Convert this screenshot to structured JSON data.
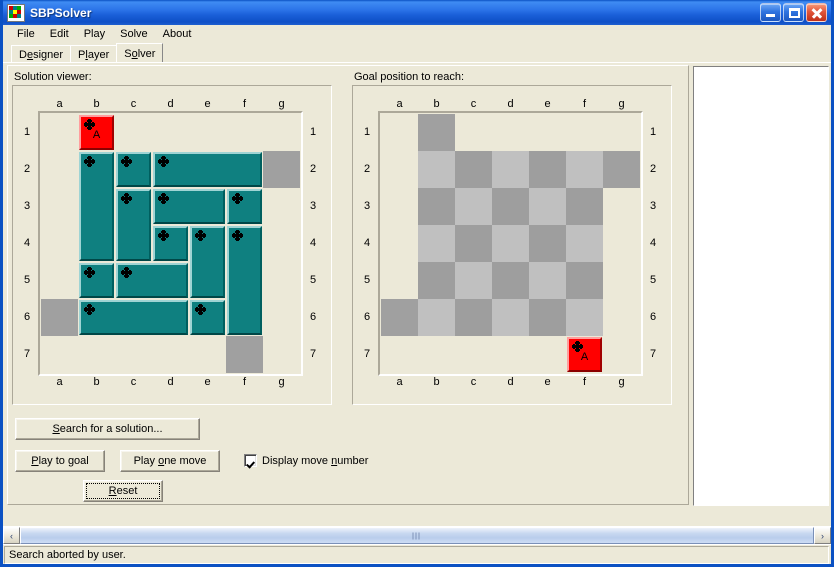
{
  "window": {
    "title": "SBPSolver",
    "icon": "app-icon",
    "buttons": {
      "minimize": "minimize",
      "maximize": "maximize",
      "close": "close"
    }
  },
  "menu": [
    {
      "label": "File"
    },
    {
      "label": "Edit"
    },
    {
      "label": "Play"
    },
    {
      "label": "Solve"
    },
    {
      "label": "About"
    }
  ],
  "tabs": [
    {
      "label": "Designer",
      "accel": "D",
      "selected": false
    },
    {
      "label": "Player",
      "accel": "l",
      "selected": false
    },
    {
      "label": "Solver",
      "accel": "o",
      "selected": true
    }
  ],
  "solver": {
    "left_label": "Solution viewer:",
    "right_label": "Goal position to reach:",
    "columns": [
      "a",
      "b",
      "c",
      "d",
      "e",
      "f",
      "g"
    ],
    "rows": [
      "1",
      "2",
      "3",
      "4",
      "5",
      "6",
      "7"
    ],
    "solution_board": {
      "blockers": [
        {
          "col": 6,
          "row": 1
        },
        {
          "col": 0,
          "row": 5
        },
        {
          "col": 5,
          "row": 6
        }
      ],
      "pieces": [
        {
          "label": "A",
          "color": "red",
          "col": 1,
          "row": 0,
          "w": 1,
          "h": 1
        },
        {
          "label": "",
          "color": "teal",
          "col": 1,
          "row": 1,
          "w": 1,
          "h": 3
        },
        {
          "label": "",
          "color": "teal",
          "col": 2,
          "row": 1,
          "w": 1,
          "h": 1
        },
        {
          "label": "",
          "color": "teal",
          "col": 3,
          "row": 1,
          "w": 3,
          "h": 1
        },
        {
          "label": "",
          "color": "teal",
          "col": 2,
          "row": 2,
          "w": 1,
          "h": 2
        },
        {
          "label": "",
          "color": "teal",
          "col": 3,
          "row": 2,
          "w": 2,
          "h": 1
        },
        {
          "label": "",
          "color": "teal",
          "col": 5,
          "row": 2,
          "w": 1,
          "h": 1
        },
        {
          "label": "",
          "color": "teal",
          "col": 3,
          "row": 3,
          "w": 1,
          "h": 1
        },
        {
          "label": "",
          "color": "teal",
          "col": 4,
          "row": 3,
          "w": 1,
          "h": 2
        },
        {
          "label": "",
          "color": "teal",
          "col": 5,
          "row": 3,
          "w": 1,
          "h": 3
        },
        {
          "label": "",
          "color": "teal",
          "col": 1,
          "row": 4,
          "w": 1,
          "h": 1
        },
        {
          "label": "",
          "color": "teal",
          "col": 2,
          "row": 4,
          "w": 2,
          "h": 1
        },
        {
          "label": "",
          "color": "teal",
          "col": 1,
          "row": 5,
          "w": 3,
          "h": 1
        },
        {
          "label": "",
          "color": "teal",
          "col": 4,
          "row": 5,
          "w": 1,
          "h": 1
        }
      ]
    },
    "goal_board": {
      "blockers": [
        {
          "col": 1,
          "row": 0
        },
        {
          "col": 6,
          "row": 1
        },
        {
          "col": 0,
          "row": 5
        }
      ],
      "checker_region": {
        "col0": 1,
        "row0": 1,
        "col1": 5,
        "row1": 5
      },
      "pieces": [
        {
          "label": "A",
          "color": "red",
          "col": 5,
          "row": 6,
          "w": 1,
          "h": 1
        }
      ]
    },
    "controls": {
      "search": {
        "pre": "",
        "accel": "S",
        "post": "earch for a solution..."
      },
      "play_to_goal": {
        "pre": "",
        "accel": "P",
        "post": "lay to goal"
      },
      "play_one_move": {
        "pre": "Play ",
        "accel": "o",
        "post": "ne move"
      },
      "reset": {
        "pre": "",
        "accel": "R",
        "post": "eset",
        "focused": true
      },
      "display_move_number": {
        "pre": "Display move ",
        "accel": "n",
        "post": "umber",
        "checked": true
      }
    }
  },
  "scrollbar": {
    "left_arrow": "‹",
    "right_arrow": "›"
  },
  "status": {
    "text": "Search aborted by user."
  },
  "colors": {
    "piece_teal": "#0f8080",
    "piece_red": "#ff0000",
    "blocker_gray": "#a0a0a0",
    "checker_dark": "#9e9e9e",
    "checker_light": "#c0c0c0",
    "face": "#ece9d8",
    "title_blue": "#0b51c3"
  }
}
